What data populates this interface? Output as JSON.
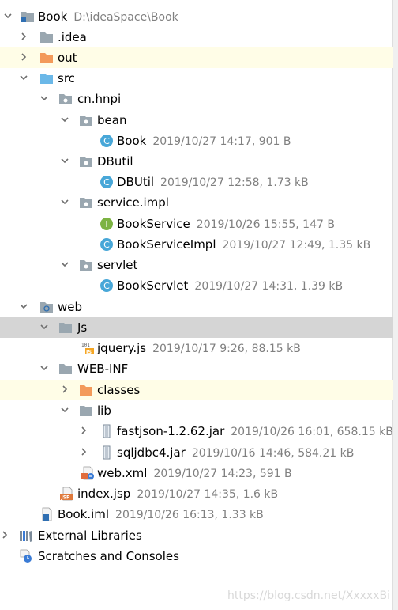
{
  "tree": {
    "root": {
      "name": "Book",
      "path": "D:\\ideaSpace\\Book"
    },
    "idea": ".idea",
    "out": "out",
    "src": "src",
    "cn_hnpi": "cn.hnpi",
    "bean": "bean",
    "book_java": {
      "name": "Book",
      "meta": "2019/10/27 14:17, 901 B"
    },
    "dbutil_pkg": "DButil",
    "dbutil_java": {
      "name": "DBUtil",
      "meta": "2019/10/27 12:58, 1.73 kB"
    },
    "service_impl": "service.impl",
    "bookservice": {
      "name": "BookService",
      "meta": "2019/10/26 15:55, 147 B"
    },
    "bookserviceimpl": {
      "name": "BookServiceImpl",
      "meta": "2019/10/27 12:49, 1.35 kB"
    },
    "servlet_pkg": "servlet",
    "bookservlet": {
      "name": "BookServlet",
      "meta": "2019/10/27 14:31, 1.39 kB"
    },
    "web": "web",
    "js": "Js",
    "jquery": {
      "name": "jquery.js",
      "meta": "2019/10/17 9:26, 88.15 kB"
    },
    "webinf": "WEB-INF",
    "classes": "classes",
    "lib": "lib",
    "fastjson": {
      "name": "fastjson-1.2.62.jar",
      "meta": "2019/10/26 16:01, 658.15 kB"
    },
    "sqljdbc": {
      "name": "sqljdbc4.jar",
      "meta": "2019/10/16 14:46, 584.21 kB"
    },
    "webxml": {
      "name": "web.xml",
      "meta": "2019/10/27 14:23, 591 B"
    },
    "indexjsp": {
      "name": "index.jsp",
      "meta": "2019/10/27 14:35, 1.6 kB"
    },
    "bookiml": {
      "name": "Book.iml",
      "meta": "2019/10/26 16:13, 1.33 kB"
    },
    "external_libraries": "External Libraries",
    "scratches": "Scratches and Consoles"
  },
  "watermark": "https://blog.csdn.net/XxxxxBi",
  "icons": {
    "expanded": "chevron-down-icon",
    "collapsed": "chevron-right-icon",
    "folder": "folder-icon",
    "package": "package-icon",
    "class": "java-class-icon",
    "interface": "java-interface-icon",
    "jar": "jar-icon",
    "js": "js-file-icon",
    "xml": "xml-file-icon",
    "jsp": "jsp-file-icon",
    "iml": "iml-file-icon",
    "libraries": "libraries-icon",
    "scratches": "scratches-icon"
  },
  "colors": {
    "selection": "#d5d5d5",
    "highlight": "#fffde7",
    "meta_text": "#808080",
    "folder_blue": "#9aa7b0",
    "source_blue": "#6bb8e8",
    "excluded_orange": "#f39a5a",
    "class_badge": "#48a7d8",
    "interface_badge": "#7cb342"
  }
}
